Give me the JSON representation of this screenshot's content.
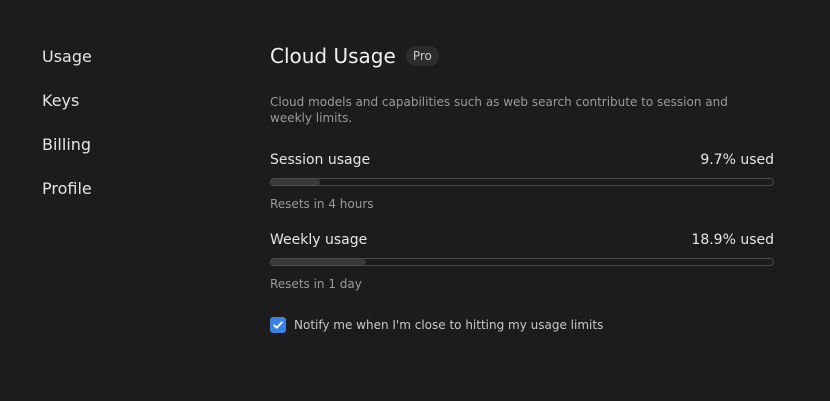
{
  "sidebar": {
    "items": [
      {
        "label": "Usage"
      },
      {
        "label": "Keys"
      },
      {
        "label": "Billing"
      },
      {
        "label": "Profile"
      }
    ]
  },
  "main": {
    "title": "Cloud Usage",
    "badge": "Pro",
    "description": "Cloud models and capabilities such as web search contribute to session and weekly limits.",
    "session": {
      "label": "Session usage",
      "value_text": "9.7% used",
      "percent": 9.7,
      "reset_text": "Resets in 4 hours"
    },
    "weekly": {
      "label": "Weekly usage",
      "value_text": "18.9% used",
      "percent": 18.9,
      "reset_text": "Resets in 1 day"
    },
    "notify": {
      "label": "Notify me when I'm close to hitting my usage limits",
      "checked": true
    }
  },
  "colors": {
    "background": "#1c1c1f",
    "accent": "#3b82e0"
  }
}
